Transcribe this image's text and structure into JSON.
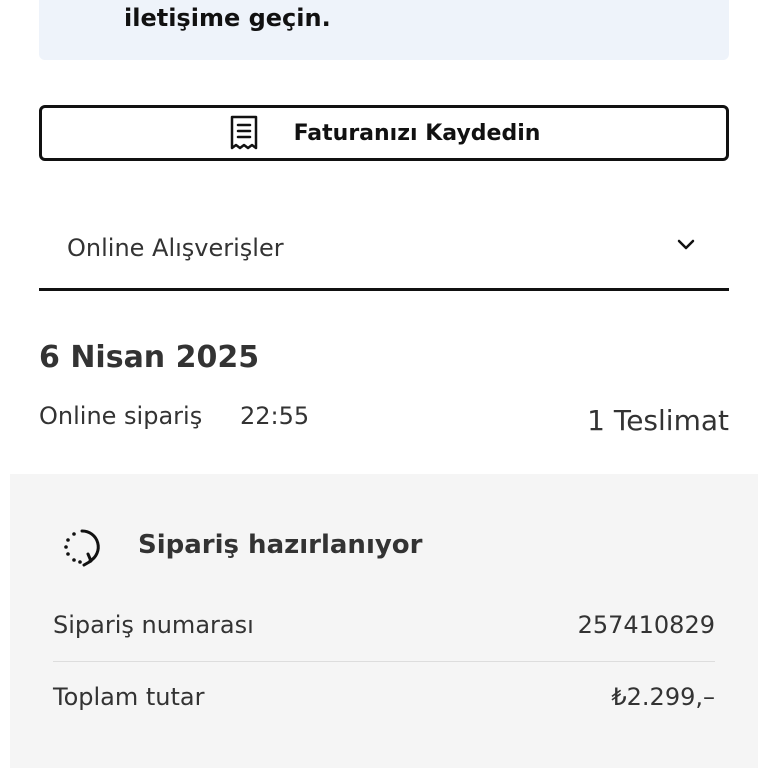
{
  "notice": {
    "text": "iletişime geçin."
  },
  "invoice_button": {
    "label": "Faturanızı Kaydedin",
    "icon": "receipt-icon"
  },
  "dropdown": {
    "selected": "Online Alışverişler",
    "icon": "chevron-down-icon"
  },
  "order": {
    "date": "6 Nisan 2025",
    "channel": "Online sipariş",
    "time": "22:55",
    "deliveries": "1 Teslimat"
  },
  "status_card": {
    "icon": "loading-icon",
    "title": "Sipariş hazırlanıyor",
    "rows": [
      {
        "label": "Sipariş numarası",
        "value": "257410829"
      },
      {
        "label": "Toplam tutar",
        "value": "₺2.299,–"
      }
    ]
  },
  "colors": {
    "notice_bg": "#eef3fa",
    "card_bg": "#f5f5f5",
    "text": "#333333",
    "border": "#111111"
  }
}
